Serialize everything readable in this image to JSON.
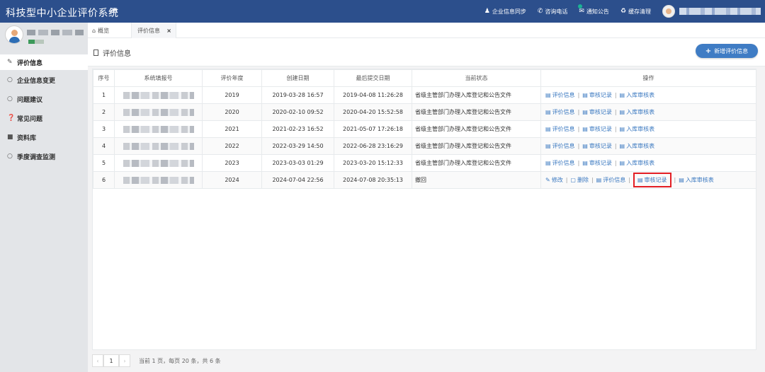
{
  "app": {
    "title": "科技型中小企业评价系统",
    "menu_icon": "hamburger-icon"
  },
  "topbar": {
    "actions": [
      {
        "label": "企业信息同步",
        "icon": "user-icon"
      },
      {
        "label": "咨询电话",
        "icon": "phone-icon"
      },
      {
        "label": "通知公告",
        "icon": "mail-icon"
      },
      {
        "label": "缓存清理",
        "icon": "recycle-icon"
      }
    ]
  },
  "sidebar": {
    "items": [
      {
        "label": "评价信息",
        "icon": "edit-icon",
        "active": true
      },
      {
        "label": "企业信息变更",
        "icon": "circle-icon"
      },
      {
        "label": "问题建议",
        "icon": "comment-icon"
      },
      {
        "label": "常见问题",
        "icon": "question-icon"
      },
      {
        "label": "资料库",
        "icon": "folder-icon"
      },
      {
        "label": "季度调查监测",
        "icon": "circle-icon"
      }
    ]
  },
  "tabs": {
    "home": "概览",
    "current": "评价信息",
    "close": "×"
  },
  "page": {
    "title": "评价信息",
    "add_button": "新增评价信息"
  },
  "table": {
    "headers": [
      "序号",
      "系统填报号",
      "评价年度",
      "创建日期",
      "最后提交日期",
      "当前状态",
      "操作"
    ],
    "rows": [
      {
        "no": "1",
        "year": "2019",
        "created": "2019-03-28 16:57",
        "submitted": "2019-04-08 11:26:28",
        "status": "省级主管部门办理入库登记和公告文件"
      },
      {
        "no": "2",
        "year": "2020",
        "created": "2020-02-10 09:52",
        "submitted": "2020-04-20 15:52:58",
        "status": "省级主管部门办理入库登记和公告文件"
      },
      {
        "no": "3",
        "year": "2021",
        "created": "2021-02-23 16:52",
        "submitted": "2021-05-07 17:26:18",
        "status": "省级主管部门办理入库登记和公告文件"
      },
      {
        "no": "4",
        "year": "2022",
        "created": "2022-03-29 14:50",
        "submitted": "2022-06-28 23:16:29",
        "status": "省级主管部门办理入库登记和公告文件"
      },
      {
        "no": "5",
        "year": "2023",
        "created": "2023-03-03 01:29",
        "submitted": "2023-03-20 15:12:33",
        "status": "省级主管部门办理入库登记和公告文件"
      },
      {
        "no": "6",
        "year": "2024",
        "created": "2024-07-04 22:56",
        "submitted": "2024-07-08 20:35:13",
        "status": "撤回"
      }
    ],
    "ops": {
      "eval": "评价信息",
      "audit": "审核记录",
      "storage": "入库审核表",
      "edit": "修改",
      "delete": "删除",
      "sep": "|"
    }
  },
  "pager": {
    "prev": "‹",
    "page": "1",
    "next": "›",
    "info": "当前 1 页，每页 20 条，共 6 条"
  }
}
